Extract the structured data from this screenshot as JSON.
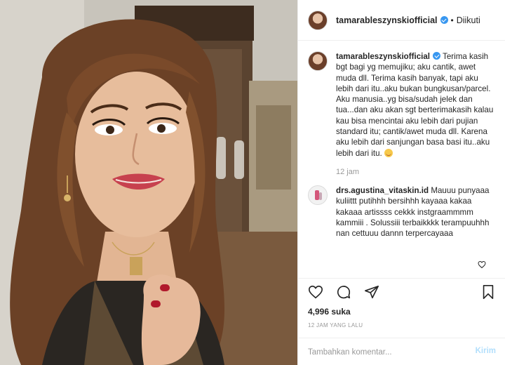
{
  "post": {
    "username": "tamarableszynskiofficial",
    "follow_label": "Diikuti",
    "dot": "•"
  },
  "caption": {
    "username": "tamarableszynskiofficial",
    "text": "Terima kasih bgt bagi yg memujiku; aku cantik, awet muda dll. Terima kasih banyak, tapi aku lebih dari itu..aku bukan bungkusan/parcel. Aku manusia..yg bisa/sudah jelek dan tua...dan aku akan sgt berterimakasih kalau kau bisa mencintai aku lebih dari pujian standard itu; cantik/awet muda dll. Karena aku lebih dari sanjungan basa basi itu..aku lebih dari itu.",
    "time": "12 jam"
  },
  "comment": {
    "username": "drs.agustina_vitaskin.id",
    "text": "Mauuu punyaaa kuliittt putihhh bersihhh kayaaa kakaa kakaaa artissss cekkk instgraammmm kammiii . Solussiii terbaikkkk terampuuhhh nan cettuuu dannn terpercayaaa"
  },
  "stats": {
    "likes": "4,996 suka",
    "ago": "12 JAM YANG LALU"
  },
  "composer": {
    "placeholder": "Tambahkan komentar...",
    "send_label": "Kirim"
  },
  "icons": {
    "like": "heart-icon",
    "comment": "comment-icon",
    "share": "share-icon",
    "save": "bookmark-icon",
    "verified": "verified-badge-icon",
    "comment_like": "small-heart-icon"
  },
  "colors": {
    "verified": "#3897f0",
    "send_disabled": "#b2dffc",
    "muted": "#999999"
  }
}
